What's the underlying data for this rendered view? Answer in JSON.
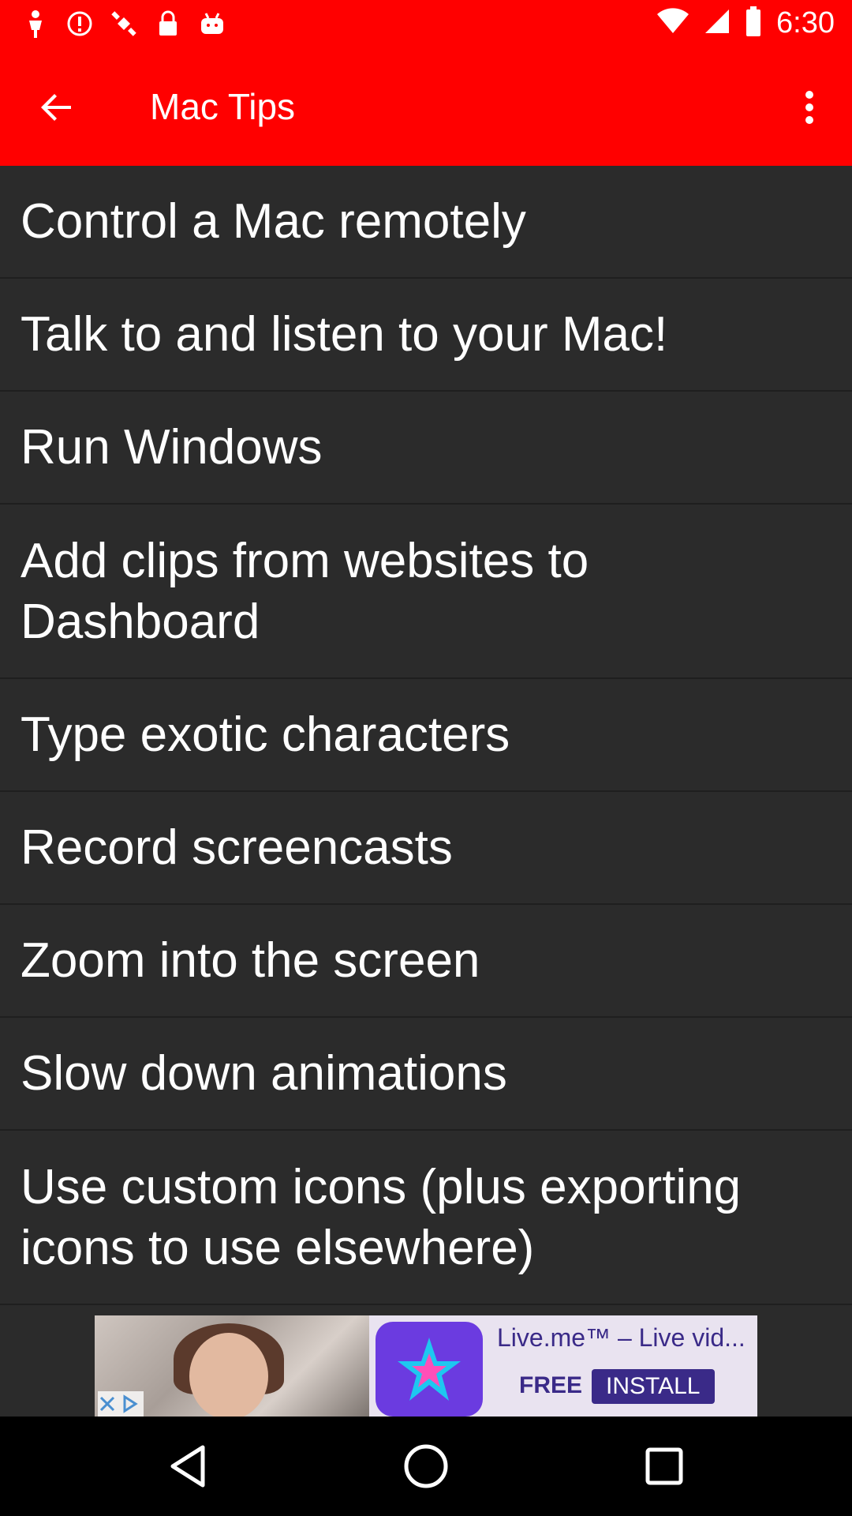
{
  "status_bar": {
    "time": "6:30",
    "left_icons": [
      "person-icon",
      "alert-icon",
      "satellite-icon",
      "lock-icon",
      "android-icon"
    ],
    "right_icons": [
      "wifi-icon",
      "signal-icon",
      "battery-icon"
    ]
  },
  "app_bar": {
    "title": "Mac Tips",
    "color": "#ff0000"
  },
  "list": {
    "items": [
      {
        "label": "Control a Mac remotely"
      },
      {
        "label": "Talk to and listen to your Mac!"
      },
      {
        "label": "Run Windows"
      },
      {
        "label": "Add clips from websites to Dashboard"
      },
      {
        "label": "Type exotic characters"
      },
      {
        "label": "Record screencasts"
      },
      {
        "label": "Zoom into the screen"
      },
      {
        "label": "Slow down animations"
      },
      {
        "label": "Use custom icons (plus exporting icons to use elsewhere)"
      }
    ]
  },
  "ad": {
    "title": "Live.me™ – Live vid...",
    "free_label": "FREE",
    "install_label": "INSTALL"
  }
}
